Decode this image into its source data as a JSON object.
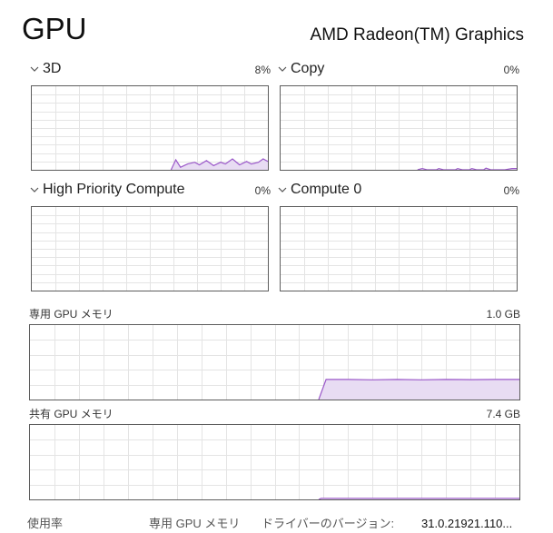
{
  "header": {
    "title": "GPU",
    "gpu_name": "AMD Radeon(TM) Graphics"
  },
  "engines": [
    {
      "label": "3D",
      "percent": "8%",
      "series": [
        0,
        0,
        0,
        0,
        0,
        0,
        0,
        0,
        0,
        0,
        0,
        0,
        0,
        0,
        0,
        0,
        0,
        0,
        0,
        0,
        0,
        0,
        0,
        0,
        0,
        0,
        0,
        0,
        0,
        0,
        0,
        0,
        0,
        0,
        0,
        0,
        0,
        0,
        0,
        0,
        0,
        0,
        0,
        0,
        0,
        0,
        0,
        0,
        0,
        0,
        0,
        0,
        0,
        0,
        0,
        0,
        0,
        0,
        0,
        0,
        0,
        0,
        0,
        0,
        0,
        0,
        0,
        0,
        0,
        0,
        0,
        0,
        0,
        0,
        0,
        0,
        0,
        0,
        0,
        0,
        0,
        0,
        0,
        0,
        0,
        0,
        0,
        0,
        0,
        0,
        0,
        0,
        0,
        0,
        0,
        0,
        0,
        0,
        0,
        0,
        0,
        0,
        0,
        0,
        0,
        0,
        0,
        0,
        0,
        0,
        0,
        0,
        0,
        0,
        0,
        0,
        0,
        0,
        0,
        0,
        0,
        0,
        0,
        0,
        0,
        0,
        0,
        0,
        0,
        0,
        0,
        0,
        0,
        0,
        0,
        0,
        0,
        0,
        0,
        0,
        0,
        0,
        0,
        0,
        0,
        0,
        0,
        0,
        0,
        0,
        0,
        0,
        0,
        0,
        0,
        0,
        0,
        0,
        0,
        0,
        0,
        0,
        0,
        0,
        0,
        0,
        0,
        0,
        0,
        0,
        0,
        0,
        0,
        0,
        0,
        0,
        0,
        0,
        0,
        0,
        0,
        0,
        0,
        0,
        0,
        0,
        0,
        0,
        0,
        0,
        0,
        0,
        0,
        0,
        0,
        0,
        0,
        0,
        0,
        0,
        0,
        0,
        0,
        0,
        0,
        0,
        0,
        0,
        0,
        0,
        0,
        0,
        0,
        0,
        0,
        0,
        0,
        0,
        0,
        0,
        0,
        0,
        0,
        0,
        0,
        0,
        0,
        0,
        0,
        0,
        0,
        0,
        0,
        0,
        0,
        0,
        0,
        0,
        0,
        0,
        0,
        0,
        0,
        0,
        0,
        0,
        0,
        0,
        0,
        0,
        0,
        0,
        0,
        0,
        0,
        0,
        0,
        0,
        0,
        0,
        0,
        0,
        0,
        0,
        0,
        0,
        0,
        0,
        0,
        0,
        0,
        0,
        0,
        0,
        0,
        0,
        0,
        0,
        0,
        0,
        0,
        0,
        0,
        0,
        0,
        0,
        0,
        0,
        0,
        0,
        0,
        0,
        0,
        0,
        0,
        0,
        0,
        0,
        0,
        0,
        0,
        0,
        0,
        0
      ]
    },
    {
      "label": "Copy",
      "percent": "0%"
    },
    {
      "label": "High Priority Compute",
      "percent": "0%"
    },
    {
      "label": "Compute 0",
      "percent": "0%"
    }
  ],
  "memory": [
    {
      "label": "専用 GPU メモリ",
      "max": "1.0 GB"
    },
    {
      "label": "共有 GPU メモリ",
      "max": "7.4 GB"
    }
  ],
  "stats": {
    "utilization_label": "使用率",
    "dedicated_label": "専用 GPU メモリ",
    "driver_label": "ドライバーのバージョン:",
    "driver_value": "31.0.21921.110..."
  },
  "chart_data": [
    {
      "type": "area",
      "name_ref": "3D",
      "ylim": [
        0,
        100
      ],
      "values": [
        0,
        0,
        0,
        0,
        0,
        0,
        0,
        0,
        0,
        0,
        0,
        0,
        0,
        0,
        0,
        0,
        0,
        0,
        0,
        0,
        0,
        0,
        0,
        0,
        0,
        0,
        0,
        0,
        0,
        0,
        0,
        0,
        0,
        0,
        0,
        0,
        0,
        0,
        0,
        0,
        0,
        0,
        0,
        0,
        0,
        0,
        0,
        0,
        0,
        0,
        0,
        0,
        0,
        0,
        0,
        0,
        0,
        0,
        0,
        0,
        0,
        0,
        0,
        0,
        0,
        0,
        0,
        0,
        0,
        0,
        0,
        0,
        0,
        0,
        0,
        0,
        0,
        0,
        0,
        0,
        0,
        0,
        0,
        0,
        0,
        0,
        0,
        0,
        0,
        0,
        0,
        0,
        0,
        0,
        0,
        0,
        0,
        0,
        0,
        0,
        0,
        0,
        0,
        0,
        0,
        0,
        0,
        0,
        0,
        0,
        0,
        0,
        0,
        0,
        0,
        0,
        0,
        0,
        0,
        0,
        0,
        0,
        0,
        0,
        0,
        0,
        0,
        0,
        0,
        0,
        0,
        0,
        0,
        0,
        0,
        0,
        0,
        0,
        0,
        0,
        0,
        0,
        0,
        0,
        0,
        0,
        0,
        0,
        0,
        0,
        0,
        0,
        0,
        0,
        0,
        0,
        0,
        0,
        0,
        0,
        0,
        0,
        0,
        0,
        0,
        0,
        0,
        0,
        0,
        0,
        0,
        0,
        0,
        0,
        0,
        0,
        0,
        0,
        0,
        0,
        0,
        0,
        0,
        0,
        0,
        0,
        0,
        0,
        0,
        0,
        0,
        0,
        0,
        0,
        0,
        0,
        0,
        0,
        0,
        0,
        0,
        0,
        0,
        0,
        0,
        0,
        0,
        0,
        0,
        0,
        0,
        0,
        0,
        0,
        0,
        0,
        0,
        0,
        0,
        0,
        0,
        0,
        0,
        0,
        0,
        0,
        0,
        0,
        0,
        0,
        0,
        0,
        0,
        0,
        0,
        0,
        0,
        0,
        0,
        0,
        0,
        0,
        0,
        0,
        0,
        0,
        0,
        0,
        0,
        0,
        0,
        0,
        0,
        0,
        0,
        0,
        0,
        0,
        0,
        0,
        0,
        0,
        0,
        0,
        0,
        0,
        0,
        0,
        0,
        0,
        0,
        0,
        0,
        0,
        0,
        0,
        0,
        0,
        0,
        0,
        0,
        0,
        0,
        0,
        0,
        0,
        0,
        0,
        0,
        0,
        0,
        0,
        0,
        0,
        0,
        0,
        0,
        0,
        0,
        0,
        0,
        0,
        0,
        0
      ]
    }
  ],
  "series": {
    "e3d": [
      0,
      0,
      0,
      0,
      0,
      0,
      0,
      0,
      0,
      0,
      0,
      0,
      0,
      0,
      0,
      0,
      0,
      0,
      0,
      0,
      0,
      0,
      0,
      0,
      0,
      0,
      0,
      0,
      0,
      0,
      0,
      0,
      0,
      0,
      0,
      0,
      0,
      0,
      0,
      0,
      0,
      0,
      0,
      0,
      0,
      0,
      0,
      0,
      0,
      0,
      0,
      0,
      0,
      0,
      0,
      0,
      0,
      0,
      0,
      0,
      0,
      0,
      0,
      0,
      0,
      0,
      0,
      0,
      0,
      0,
      0,
      0,
      0,
      0,
      0,
      0,
      0,
      0,
      0,
      0,
      0,
      0,
      0,
      0,
      0,
      0,
      0,
      0,
      0,
      0,
      0,
      0,
      0,
      0,
      0,
      0,
      0,
      0,
      0,
      0,
      0,
      0,
      0,
      0,
      0,
      0,
      0,
      0,
      0,
      0,
      0,
      0,
      0,
      0,
      0,
      0,
      0,
      0,
      0,
      0,
      0,
      0,
      0,
      0,
      0,
      0,
      0,
      0,
      0,
      0,
      0,
      0,
      0,
      0,
      0,
      0,
      0,
      0,
      0,
      0,
      0,
      0,
      0,
      0,
      0,
      0,
      0,
      0,
      0,
      0,
      0,
      0,
      0,
      0,
      0,
      0,
      0,
      0,
      0,
      0,
      0,
      0,
      0,
      0,
      0,
      0,
      0,
      0,
      0,
      0,
      0,
      0,
      0,
      0,
      0,
      0,
      0,
      0,
      0,
      0,
      0,
      0,
      0,
      0,
      0,
      0,
      0,
      0,
      0,
      0,
      0,
      0,
      0,
      0,
      0,
      0,
      0,
      0,
      0,
      0,
      0,
      0,
      0,
      0,
      0,
      0,
      0,
      0,
      0,
      0,
      0,
      0,
      0,
      0,
      0,
      0,
      0,
      0,
      0,
      0,
      0,
      0,
      0,
      0,
      0,
      0,
      0,
      0,
      0,
      0,
      0,
      0,
      0,
      0,
      0,
      0,
      0,
      0,
      0,
      0,
      0,
      0,
      0,
      0,
      0,
      0,
      0,
      0,
      0,
      0,
      0,
      0,
      0,
      0,
      0,
      0,
      0,
      0,
      0,
      0,
      0,
      0,
      0,
      0,
      0,
      0,
      0,
      0,
      0,
      0,
      0,
      0,
      0,
      0,
      0,
      0,
      0,
      0,
      0,
      0,
      0,
      0,
      0,
      0,
      0,
      0,
      0,
      0,
      0,
      0,
      0,
      0,
      0,
      0,
      0,
      0,
      0,
      0,
      0,
      0,
      0,
      0,
      0,
      0,
      0
    ]
  },
  "colors": {
    "line": "#9b59c9",
    "fill": "#e8dcf3",
    "grid": "#e4e4e4",
    "border": "#5d5d5d"
  }
}
